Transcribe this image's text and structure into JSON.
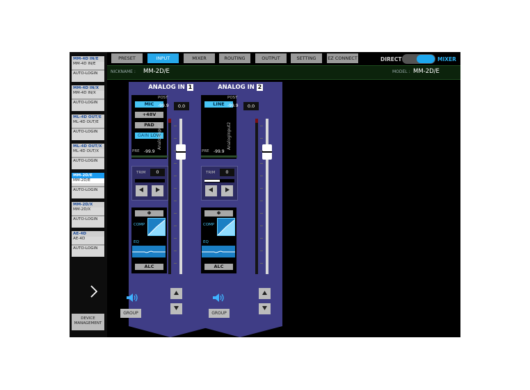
{
  "sidebar": {
    "devices": [
      {
        "title": "MM-4D IN/E",
        "model": "MM-4D IN/E",
        "status": "AUTO-LOGIN",
        "selected": false
      },
      {
        "title": "MM-4D IN/X",
        "model": "MM-4D IN/X",
        "status": "AUTO-LOGIN",
        "selected": false
      },
      {
        "title": "ML-4D OUT/E",
        "model": "ML-4D OUT/E",
        "status": "AUTO-LOGIN",
        "selected": false
      },
      {
        "title": "ML-4D OUT/X",
        "model": "ML-4D OUT/X",
        "status": "AUTO-LOGIN",
        "selected": false
      },
      {
        "title": "MM-2D/E",
        "model": "MM-2D/E",
        "status": "AUTO-LOGIN",
        "selected": true
      },
      {
        "title": "MM-2D/X",
        "model": "MM-2D/X",
        "status": "AUTO-LOGIN",
        "selected": false
      },
      {
        "title": "AE-4D",
        "model": "AE-4D",
        "status": "AUTO-LOGIN",
        "selected": false
      }
    ],
    "next_icon": "chevron-right-icon",
    "device_management": "DEVICE MANAGEMENT"
  },
  "tabs": [
    {
      "label": "PRESET",
      "active": false
    },
    {
      "label": "INPUT",
      "active": true
    },
    {
      "label": "MIXER",
      "active": false
    },
    {
      "label": "ROUTING",
      "active": false
    },
    {
      "label": "OUTPUT",
      "active": false
    },
    {
      "label": "SETTING",
      "active": false
    },
    {
      "label": "EZ CONNECT",
      "active": false
    }
  ],
  "mode": {
    "left": "DIRECT",
    "right": "MIXER",
    "selected": "MIXER"
  },
  "info": {
    "nickname_label": "NICKNAME :",
    "nickname": "MM-2D/E",
    "model_label": "MODEL :",
    "model": "MM-2D/E"
  },
  "channels": [
    {
      "title": "ANALOG IN",
      "number": "1",
      "name": "AnalogInput1",
      "input_type": "MIC",
      "phantom": "+48V",
      "pad": "PAD",
      "gain_label": "GAIN",
      "gain_value": "LOW",
      "post_label": "POST",
      "post_value": "-99.9",
      "post_sub": "0.0",
      "pre_label": "PRE",
      "pre_value": "-99.9",
      "trim_label": "TRIM",
      "trim_value": "0",
      "phase": "Φ",
      "comp_label": "COMP",
      "eq_label": "EQ",
      "alc_label": "ALC",
      "group_label": "GROUP",
      "speaker_icon": "speaker-icon",
      "has_trim_bar": false
    },
    {
      "title": "ANALOG IN",
      "number": "2",
      "name": "AnalogInput2",
      "input_type": "LINE",
      "post_label": "POST",
      "post_value": "-99.9",
      "post_sub": "0.0",
      "pre_label": "PRE",
      "pre_value": "-99.9",
      "trim_label": "TRIM",
      "trim_value": "0",
      "phase": "Φ",
      "comp_label": "COMP",
      "eq_label": "EQ",
      "alc_label": "ALC",
      "group_label": "GROUP",
      "speaker_icon": "speaker-icon",
      "has_trim_bar": true
    }
  ],
  "colors": {
    "accent": "#27a8ea",
    "channel": "#3f3d86",
    "infobar": "#0c230c"
  }
}
